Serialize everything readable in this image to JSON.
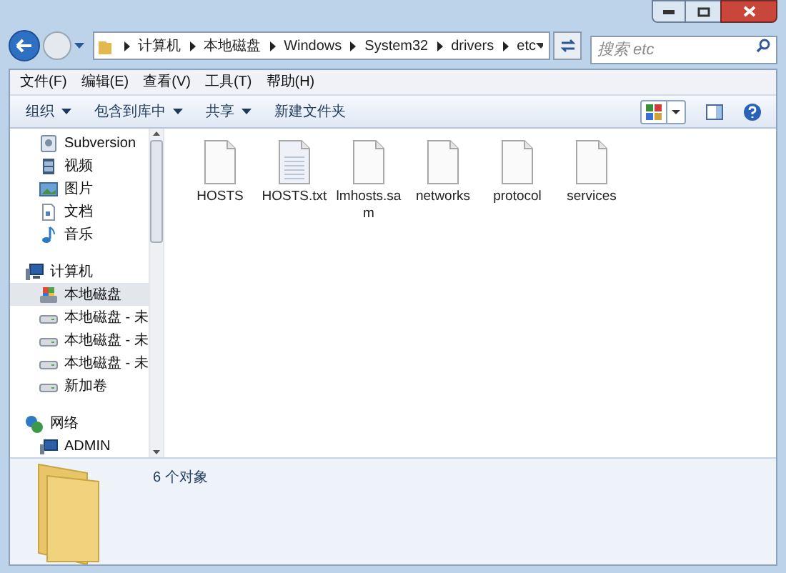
{
  "address": {
    "crumbs": [
      "计算机",
      "本地磁盘",
      "Windows",
      "System32",
      "drivers",
      "etc"
    ]
  },
  "search": {
    "placeholder": "搜索 etc"
  },
  "menu": [
    "文件(F)",
    "编辑(E)",
    "查看(V)",
    "工具(T)",
    "帮助(H)"
  ],
  "toolbar": [
    {
      "label": "组织",
      "dropdown": true
    },
    {
      "label": "包含到库中",
      "dropdown": true
    },
    {
      "label": "共享",
      "dropdown": true
    },
    {
      "label": "新建文件夹",
      "dropdown": false
    }
  ],
  "sidebar": {
    "items": [
      {
        "label": "Subversion",
        "kind": "library",
        "selected": false
      },
      {
        "label": "视频",
        "kind": "video",
        "selected": false
      },
      {
        "label": "图片",
        "kind": "picture",
        "selected": false
      },
      {
        "label": "文档",
        "kind": "document",
        "selected": false
      },
      {
        "label": "音乐",
        "kind": "music",
        "selected": false
      },
      {
        "label": "计算机",
        "kind": "computer",
        "selected": false
      },
      {
        "label": "本地磁盘",
        "kind": "system-drive",
        "selected": true
      },
      {
        "label": "本地磁盘 - 未",
        "kind": "drive",
        "selected": false
      },
      {
        "label": "本地磁盘 - 未",
        "kind": "drive",
        "selected": false
      },
      {
        "label": "本地磁盘 - 未",
        "kind": "drive",
        "selected": false
      },
      {
        "label": "新加卷",
        "kind": "drive",
        "selected": false
      },
      {
        "label": "网络",
        "kind": "network",
        "selected": false
      },
      {
        "label": "ADMIN",
        "kind": "pc",
        "selected": false
      }
    ]
  },
  "files": [
    {
      "name": "HOSTS",
      "kind": "file"
    },
    {
      "name": "HOSTS.txt",
      "kind": "text"
    },
    {
      "name": "lmhosts.sam",
      "kind": "file"
    },
    {
      "name": "networks",
      "kind": "file"
    },
    {
      "name": "protocol",
      "kind": "file"
    },
    {
      "name": "services",
      "kind": "file"
    }
  ],
  "status_bar": {
    "text": "6 个对象"
  }
}
